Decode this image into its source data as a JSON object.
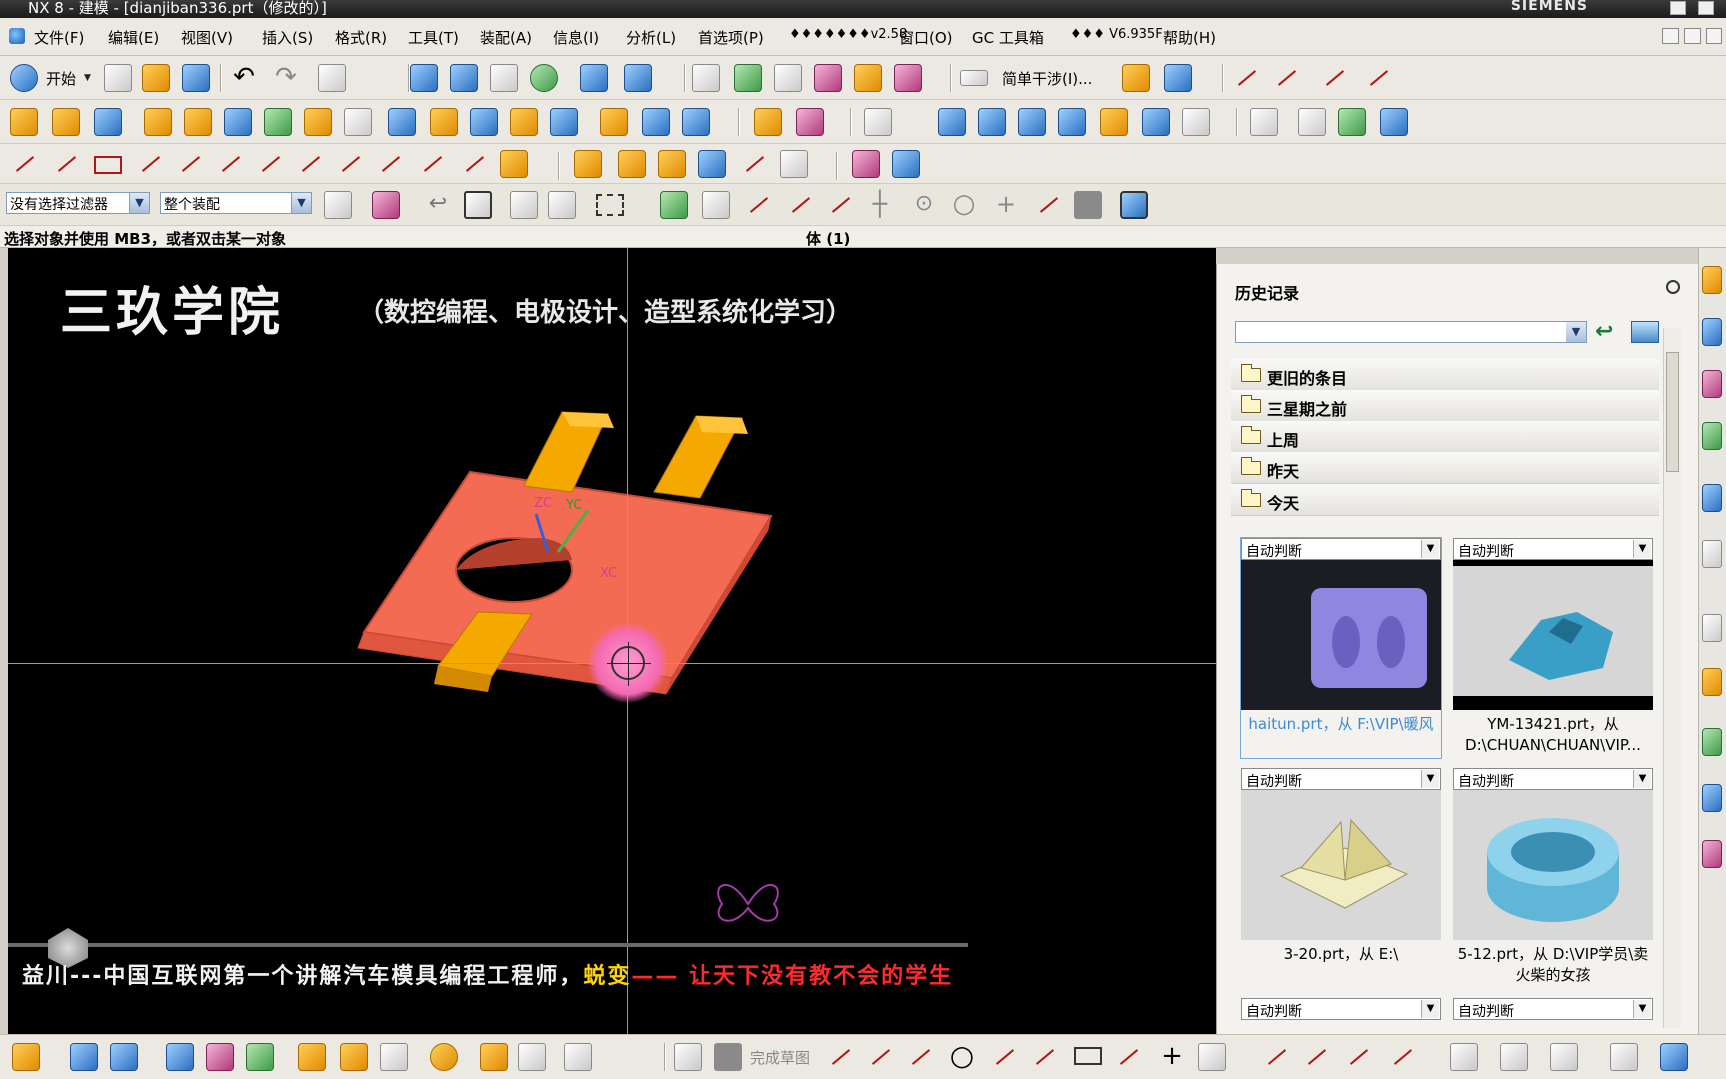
{
  "window": {
    "title": "NX 8 - 建模 - [dianjiban336.prt（修改的）]",
    "brand": "SIEMENS"
  },
  "menu": [
    "文件(F)",
    "编辑(E)",
    "视图(V)",
    "插入(S)",
    "格式(R)",
    "工具(T)",
    "装配(A)",
    "信息(I)",
    "分析(L)",
    "首选项(P)",
    "♦♦♦♦♦♦♦v2.58",
    "窗口(O)",
    "GC 工具箱",
    "♦♦♦ V6.935F",
    "帮助(H)"
  ],
  "toolbar": {
    "start_label": "开始",
    "simple_interference_label": "简单干涉(I)...",
    "filter_combo": "没有选择过滤器",
    "scope_combo": "整个装配"
  },
  "cue": {
    "prompt": "选择对象并使用 MB3，或者双击某一对象",
    "status": "体 (1)"
  },
  "graphics": {
    "banner_main": "三玖学院",
    "banner_sub": "（数控编程、电极设计、造型系统化学习）",
    "wcs_zc": "ZC",
    "wcs_yc": "YC",
    "wcs_xc": "XC",
    "caption_part1": "益川---中国互联网第一个讲解汽车模具编程工程师，",
    "caption_part2": "蜕变",
    "caption_part3": "—— 让天下没有教不会的学生",
    "colors": {
      "plate": "#f46b53",
      "blocks": "#f5a800",
      "highlight": "#f472b6"
    }
  },
  "history": {
    "title": "历史记录",
    "groups": [
      "更旧的条目",
      "三星期之前",
      "上周",
      "昨天",
      "今天"
    ],
    "cards": [
      {
        "mode": "自动判断",
        "caption": "haitun.prt，从 F:\\VIP\\暖风",
        "thumb": "dolphin-mold"
      },
      {
        "mode": "自动判断",
        "caption": "YM-13421.prt，从 D:\\CHUAN\\CHUAN\\VIP...",
        "thumb": "blue-core"
      },
      {
        "mode": "自动判断",
        "caption": "3-20.prt，从 E:\\",
        "thumb": "folded-block"
      },
      {
        "mode": "自动判断",
        "caption": "5-12.prt，从 D:\\VIP学员\\卖火柴的女孩",
        "thumb": "ring"
      },
      {
        "mode": "自动判断",
        "caption": "",
        "thumb": ""
      },
      {
        "mode": "自动判断",
        "caption": "",
        "thumb": ""
      }
    ]
  },
  "bottombar": {
    "finish_sketch": "完成草图"
  }
}
